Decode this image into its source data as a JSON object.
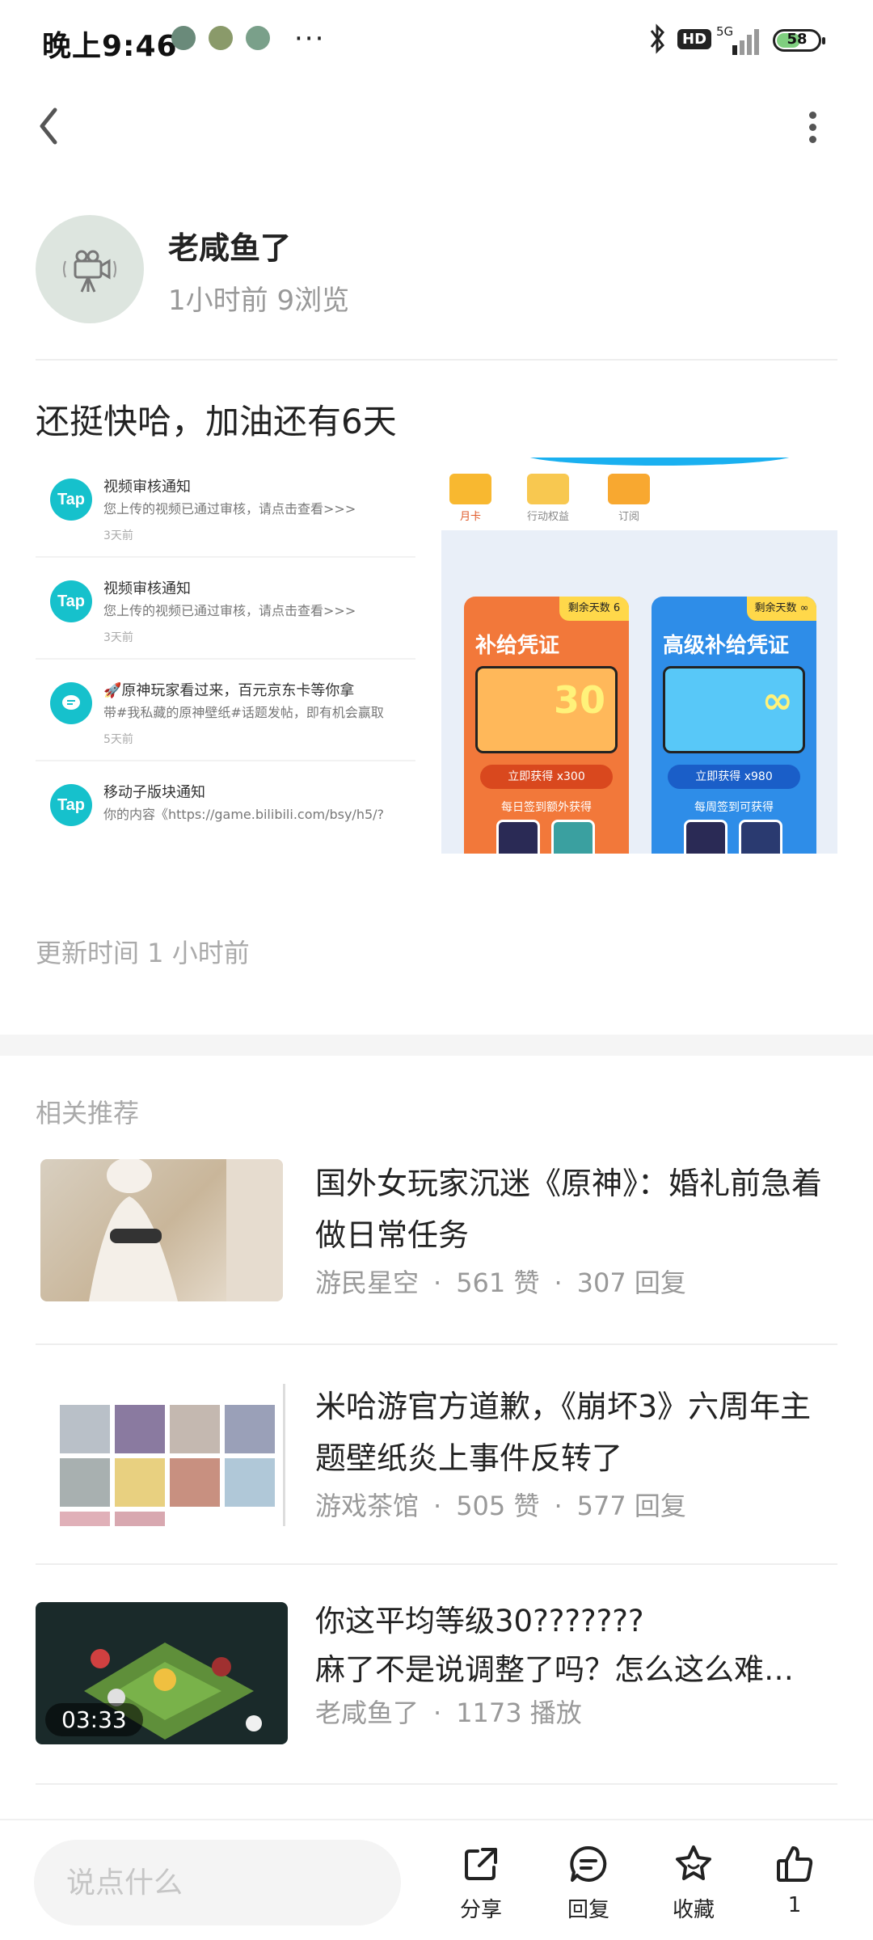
{
  "status_bar": {
    "time": "晚上9:46",
    "dots": "···",
    "hd": "HD",
    "network": "5G",
    "battery": "58",
    "battery_level": 0.58
  },
  "author": {
    "name": "老咸鱼了",
    "meta": "1小时前 9浏览"
  },
  "post": {
    "title": "还挺快哈，加油还有6天",
    "update_time": "更新时间 1 小时前"
  },
  "image_left": {
    "notifications": [
      {
        "logo": "Tap",
        "title": "视频审核通知",
        "body": "您上传的视频已通过审核，请点击查看>>>",
        "time": "3天前"
      },
      {
        "logo": "Tap",
        "title": "视频审核通知",
        "body": "您上传的视频已通过审核，请点击查看>>>",
        "time": "3天前"
      },
      {
        "logo": "",
        "title": "🚀原神玩家看过来，百元京东卡等你拿",
        "body": "带#我私藏的原神壁纸#话题发帖，即有机会赢取",
        "time": "5天前"
      },
      {
        "logo": "Tap",
        "title": "移动子版块通知",
        "body": "你的内容《https://game.bilibili.com/bsy/h5/?",
        "time": ""
      }
    ]
  },
  "image_right": {
    "tabs": [
      "月卡",
      "行动权益",
      "订阅"
    ],
    "card_orange": {
      "badge": "剩余天数 6",
      "title": "补给凭证",
      "big": "30",
      "button": "立即获得 x300",
      "sub": "每日签到额外获得"
    },
    "card_blue": {
      "badge": "剩余天数 ∞",
      "title": "高级补给凭证",
      "big": "∞",
      "button": "立即获得 x980",
      "sub": "每周签到可获得"
    }
  },
  "related": {
    "title": "相关推荐",
    "items": [
      {
        "title": "国外女玩家沉迷《原神》：婚礼前急着做日常任务",
        "source": "游民星空",
        "stat1": "561 赞",
        "stat2": "307 回复"
      },
      {
        "title": "米哈游官方道歉，《崩坏3》六周年主题壁纸炎上事件反转了",
        "source": "游戏茶馆",
        "stat1": "505 赞",
        "stat2": "577 回复"
      },
      {
        "title": "你这平均等级30???????\n麻了不是说调整了吗？怎么这么难…",
        "source": "老咸鱼了",
        "stat1": "1173 播放",
        "duration": "03:33"
      }
    ]
  },
  "bottom": {
    "placeholder": "说点什么",
    "share": "分享",
    "reply": "回复",
    "favorite": "收藏",
    "like_count": "1"
  },
  "colors": {
    "accent_tap": "#16c1cc",
    "text_primary": "#222222",
    "text_secondary": "#999999"
  }
}
